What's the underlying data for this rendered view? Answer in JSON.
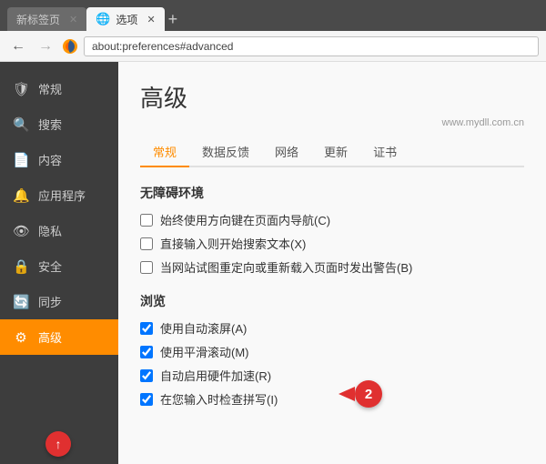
{
  "browser": {
    "tabs": [
      {
        "id": "newtab",
        "label": "新标签页",
        "active": false
      },
      {
        "id": "prefs",
        "label": "选项",
        "active": true
      }
    ],
    "new_tab_label": "+",
    "url": "about:preferences#advanced"
  },
  "nav": {
    "back": "←",
    "forward": "→"
  },
  "sidebar": {
    "items": [
      {
        "id": "general",
        "label": "常规",
        "icon": "🛡"
      },
      {
        "id": "search",
        "label": "搜索",
        "icon": "🔍"
      },
      {
        "id": "content",
        "label": "内容",
        "icon": "📄"
      },
      {
        "id": "apps",
        "label": "应用程序",
        "icon": "🔔"
      },
      {
        "id": "privacy",
        "label": "隐私",
        "icon": "👁"
      },
      {
        "id": "security",
        "label": "安全",
        "icon": "🔒"
      },
      {
        "id": "sync",
        "label": "同步",
        "icon": "🔄"
      },
      {
        "id": "advanced",
        "label": "高级",
        "icon": "⚙",
        "active": true
      }
    ]
  },
  "content": {
    "page_title": "高级",
    "watermark": "www.mydll.com.cn",
    "tabs": [
      {
        "id": "general",
        "label": "常规",
        "active": true
      },
      {
        "id": "feedback",
        "label": "数据反馈"
      },
      {
        "id": "network",
        "label": "网络"
      },
      {
        "id": "update",
        "label": "更新"
      },
      {
        "id": "certs",
        "label": "证书"
      }
    ],
    "sections": {
      "accessibility": {
        "title": "无障碍环境",
        "items": [
          {
            "id": "use_cursor",
            "label": "始终使用方向键在页面内导航(C)",
            "checked": false
          },
          {
            "id": "search_start",
            "label": "直接输入则开始搜索文本(X)",
            "checked": false
          },
          {
            "id": "warn_redirect",
            "label": "当网站试图重定向或重新载入页面时发出警告(B)",
            "checked": false
          }
        ]
      },
      "browsing": {
        "title": "浏览",
        "items": [
          {
            "id": "autoscroll",
            "label": "使用自动滚屏(A)",
            "checked": true
          },
          {
            "id": "smooth_scroll",
            "label": "使用平滑滚动(M)",
            "checked": true
          },
          {
            "id": "hardware_accel",
            "label": "自动启用硬件加速(R)",
            "checked": true
          },
          {
            "id": "spell_check",
            "label": "在您输入时检查拼写(I)",
            "checked": true
          }
        ]
      }
    }
  },
  "annotations": {
    "arrow_label": "↑",
    "badge_label": "2"
  }
}
